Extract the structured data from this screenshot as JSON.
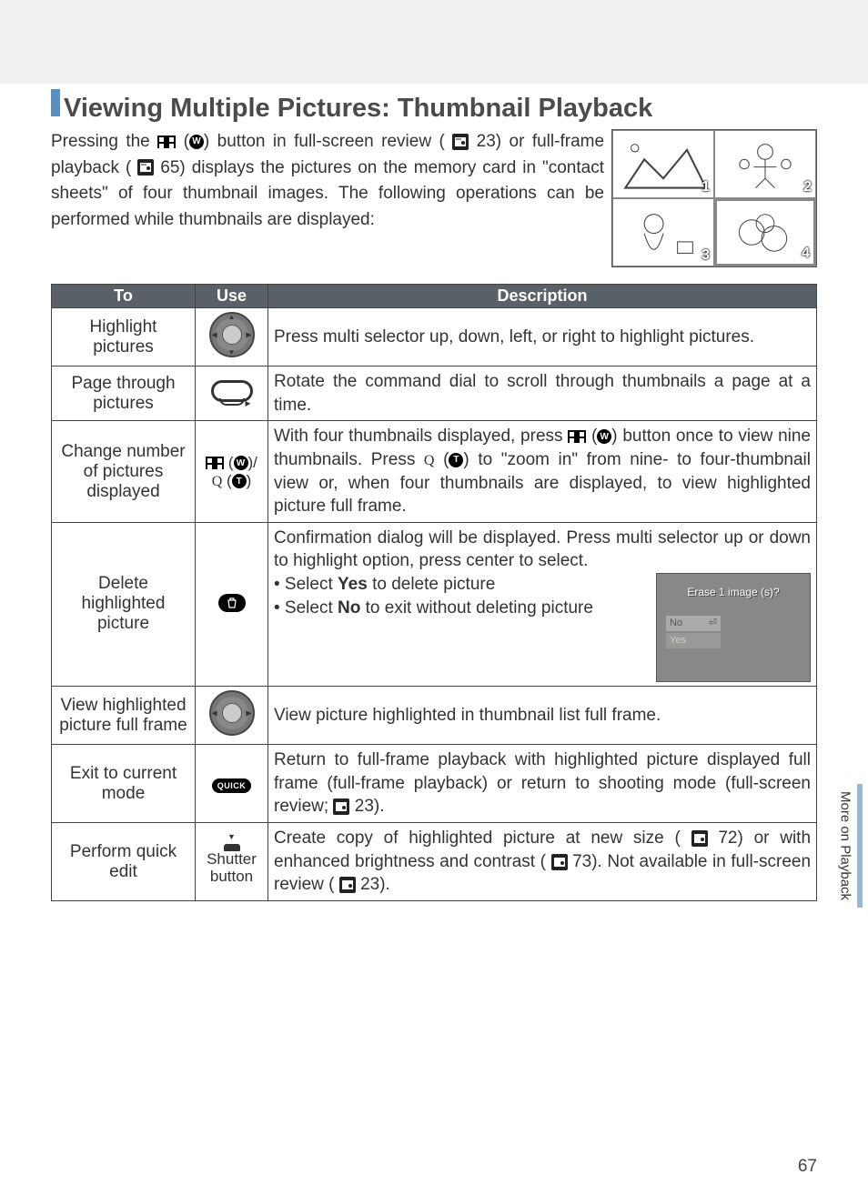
{
  "heading": "Viewing Multiple Pictures: Thumbnail Playback",
  "intro": {
    "a": "Pressing the ",
    "b": " button in full-screen review (",
    "ref1": "23",
    "c": ") or full-frame playback (",
    "ref2": "65",
    "d": ")  displays the pictures on the memory card in \"contact sheets\" of four thumbnail images.  The following operations can be performed while thumbnails are displayed:"
  },
  "thumbs": [
    "1",
    "2",
    "3",
    "4"
  ],
  "table": {
    "headers": {
      "to": "To",
      "use": "Use",
      "desc": "Description"
    },
    "rows": [
      {
        "to": "Highlight pictures",
        "desc": "Press multi selector up, down, left, or right to highlight pictures."
      },
      {
        "to": "Page through pictures",
        "desc": "Rotate the command dial to scroll through thumbnails a page at a time."
      },
      {
        "to": "Change number of pictures displayed",
        "desc_a": "With four thumbnails displayed, press ",
        "desc_b": " button once to view nine thumbnails.  Press ",
        "desc_c": " to \"zoom in\" from nine- to four-thumbnail view or, when four thumbnails are displayed, to view highlighted picture full frame."
      },
      {
        "to": "Delete highlighted picture",
        "desc_top": "Confirmation dialog will be displayed.  Press multi selector up or down to highlight option, press center to select.",
        "bullet1a": "• Select ",
        "bullet1b": "Yes",
        "bullet1c": " to delete picture",
        "bullet2a": "• Select ",
        "bullet2b": "No",
        "bullet2c": " to exit without deleting picture",
        "dialog": {
          "q": "Erase 1 image (s)?",
          "no": "No",
          "yes": "Yes"
        }
      },
      {
        "to": "View highlighted picture full frame",
        "desc": "View picture highlighted in thumbnail list full frame."
      },
      {
        "to": "Exit to current mode",
        "desc_a": "Return to full-frame playback with highlighted picture displayed full frame (full-frame playback) or return to shooting mode (full-screen review; ",
        "ref": "23",
        "desc_b": ")."
      },
      {
        "to": "Perform quick edit",
        "use": "Shutter button",
        "desc_a": "Create copy of highlighted picture at new size (",
        "ref1": "72",
        "desc_b": ") or with enhanced brightness and contrast (",
        "ref2": "73",
        "desc_c": ").  Not available in full-screen review (",
        "ref3": "23",
        "desc_d": ")."
      }
    ]
  },
  "quick_label": "QUICK",
  "side_tab": "More on Playback",
  "page_number": "67"
}
